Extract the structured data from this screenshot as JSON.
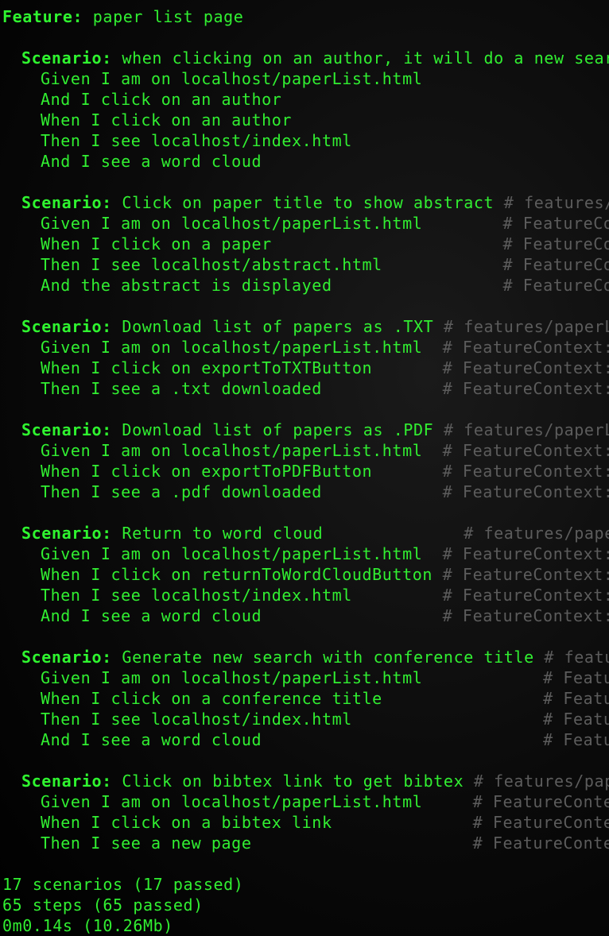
{
  "feature": {
    "keyword": "Feature:",
    "title": " paper list page"
  },
  "scenarios": [
    {
      "keyword": "Scenario:",
      "title": " when clicking on an author, it will do a new search",
      "comment": "",
      "steps": [
        {
          "text": "Given I am on localhost/paperList.html",
          "comment": ""
        },
        {
          "text": "And I click on an author",
          "comment": ""
        },
        {
          "text": "When I click on an author",
          "comment": ""
        },
        {
          "text": "Then I see localhost/index.html",
          "comment": ""
        },
        {
          "text": "And I see a word cloud",
          "comment": ""
        }
      ]
    },
    {
      "keyword": "Scenario:",
      "title": " Click on paper title to show abstract ",
      "comment": "# features/pap",
      "steps": [
        {
          "text": "Given I am on localhost/paperList.html        ",
          "comment": "# FeatureConte"
        },
        {
          "text": "When I click on a paper                       ",
          "comment": "# FeatureConte"
        },
        {
          "text": "Then I see localhost/abstract.html            ",
          "comment": "# FeatureConte"
        },
        {
          "text": "And the abstract is displayed                 ",
          "comment": "# FeatureConte"
        }
      ]
    },
    {
      "keyword": "Scenario:",
      "title": " Download list of papers as .TXT ",
      "comment": "# features/paperList",
      "steps": [
        {
          "text": "Given I am on localhost/paperList.html  ",
          "comment": "# FeatureContext::iA"
        },
        {
          "text": "When I click on exportToTXTButton       ",
          "comment": "# FeatureContext::iC"
        },
        {
          "text": "Then I see a .txt downloaded            ",
          "comment": "# FeatureContext::iS"
        }
      ]
    },
    {
      "keyword": "Scenario:",
      "title": " Download list of papers as .PDF ",
      "comment": "# features/paperList",
      "steps": [
        {
          "text": "Given I am on localhost/paperList.html  ",
          "comment": "# FeatureContext::iA"
        },
        {
          "text": "When I click on exportToPDFButton       ",
          "comment": "# FeatureContext::iC"
        },
        {
          "text": "Then I see a .pdf downloaded            ",
          "comment": "# FeatureContext::iS"
        }
      ]
    },
    {
      "keyword": "Scenario:",
      "title": " Return to word cloud              ",
      "comment": "# features/paperList",
      "steps": [
        {
          "text": "Given I am on localhost/paperList.html  ",
          "comment": "# FeatureContext::iA"
        },
        {
          "text": "When I click on returnToWordCloudButton ",
          "comment": "# FeatureContext::iC"
        },
        {
          "text": "Then I see localhost/index.html         ",
          "comment": "# FeatureContext::iS"
        },
        {
          "text": "And I see a word cloud                  ",
          "comment": "# FeatureContext::iS"
        }
      ]
    },
    {
      "keyword": "Scenario:",
      "title": " Generate new search with conference title ",
      "comment": "# features",
      "steps": [
        {
          "text": "Given I am on localhost/paperList.html            ",
          "comment": "# FeatureC"
        },
        {
          "text": "When I click on a conference title                ",
          "comment": "# FeatureC"
        },
        {
          "text": "Then I see localhost/index.html                   ",
          "comment": "# FeatureC"
        },
        {
          "text": "And I see a word cloud                            ",
          "comment": "# FeatureC"
        }
      ]
    },
    {
      "keyword": "Scenario:",
      "title": " Click on bibtex link to get bibtex ",
      "comment": "# features/paperL",
      "steps": [
        {
          "text": "Given I am on localhost/paperList.html     ",
          "comment": "# FeatureContext:"
        },
        {
          "text": "When I click on a bibtex link              ",
          "comment": "# FeatureContext:"
        },
        {
          "text": "Then I see a new page                      ",
          "comment": "# FeatureContext:"
        }
      ]
    }
  ],
  "summary": {
    "scenarios": "17 scenarios (17 passed)",
    "steps": "65 steps (65 passed)",
    "time": "0m0.14s (10.26Mb)"
  },
  "colors": {
    "text": "#31ef31",
    "comment": "#5c5c5c",
    "background": "#000000"
  }
}
